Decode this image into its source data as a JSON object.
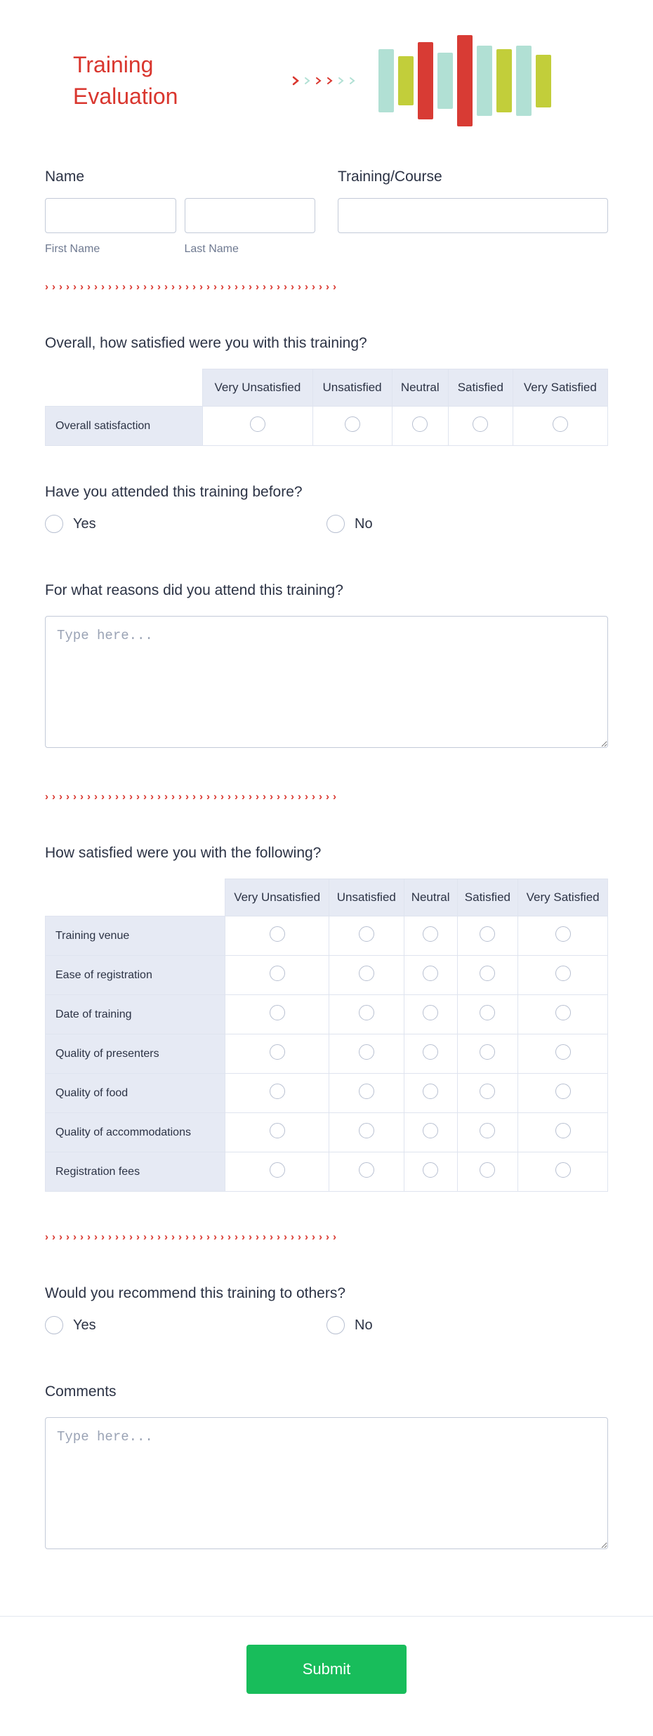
{
  "title": "Training\nEvaluation",
  "name": {
    "label": "Name",
    "first_sub": "First Name",
    "last_sub": "Last Name"
  },
  "course": {
    "label": "Training/Course"
  },
  "scale": [
    "Very Unsatisfied",
    "Unsatisfied",
    "Neutral",
    "Satisfied",
    "Very Satisfied"
  ],
  "q_overall": {
    "label": "Overall, how satisfied were you with this training?",
    "rows": [
      "Overall satisfaction"
    ]
  },
  "q_before": {
    "label": "Have you attended this training before?",
    "yes": "Yes",
    "no": "No"
  },
  "q_reason": {
    "label": "For what reasons did you attend this training?",
    "placeholder": "Type here..."
  },
  "q_items": {
    "label": "How satisfied were you with the following?",
    "rows": [
      "Training venue",
      "Ease of registration",
      "Date of training",
      "Quality of presenters",
      "Quality of food",
      "Quality of accommodations",
      "Registration fees"
    ]
  },
  "q_recommend": {
    "label": "Would you recommend this training to others?",
    "yes": "Yes",
    "no": "No"
  },
  "q_comments": {
    "label": "Comments",
    "placeholder": "Type here..."
  },
  "submit": "Submit"
}
